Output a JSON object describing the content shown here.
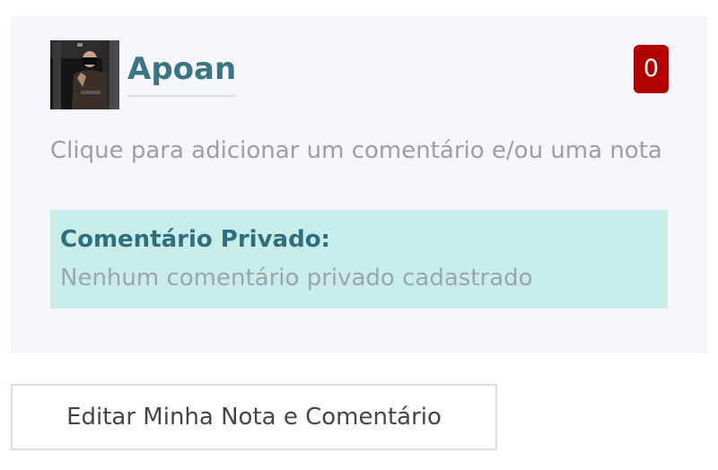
{
  "review": {
    "user_name": "Apoan",
    "grade": "0",
    "comment_prompt": "Clique para adicionar um comentário e/ou uma nota",
    "private_comment": {
      "title": "Comentário Privado:",
      "empty_text": "Nenhum comentário privado cadastrado"
    }
  },
  "actions": {
    "edit_label": "Editar Minha Nota e Comentário"
  },
  "colors": {
    "accent": "#3a7585",
    "badge": "#b00000",
    "private_bg": "#c8ede9",
    "card_bg": "#f5f6fc"
  },
  "icons": {
    "avatar": "user-avatar-photo"
  }
}
